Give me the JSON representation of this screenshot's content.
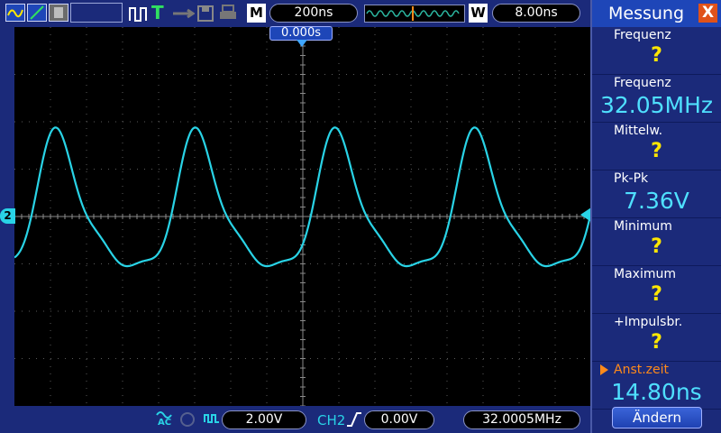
{
  "topbar": {
    "timebase": "200ns",
    "window": "8.00ns",
    "memory_mark": "M",
    "window_mark": "W",
    "trigger_mark": "T",
    "trigger_time": "0.000s"
  },
  "channel": {
    "marker": "2"
  },
  "bottombar": {
    "coupling": "AC",
    "volts_div": "2.00V",
    "trigger_source": "CH2",
    "trigger_level": "0.00V",
    "counter": "32.0005MHz"
  },
  "panel": {
    "title": "Messung",
    "close": "X",
    "edit_label": "Ändern",
    "items": [
      {
        "label": "Frequenz",
        "value": "?"
      },
      {
        "label": "Frequenz",
        "value": "32.05MHz"
      },
      {
        "label": "Mittelw.",
        "value": "?"
      },
      {
        "label": "Pk-Pk",
        "value": "7.36V"
      },
      {
        "label": "Minimum",
        "value": "?"
      },
      {
        "label": "Maximum",
        "value": "?"
      },
      {
        "label": "+Impulsbr.",
        "value": "?"
      },
      {
        "label": "Anst.zeit",
        "value": "14.80ns"
      }
    ]
  },
  "colors": {
    "trace": "#29d3e6",
    "panel_bg": "#1b2a7a",
    "accent": "#e0521a",
    "question": "#ffe600"
  }
}
